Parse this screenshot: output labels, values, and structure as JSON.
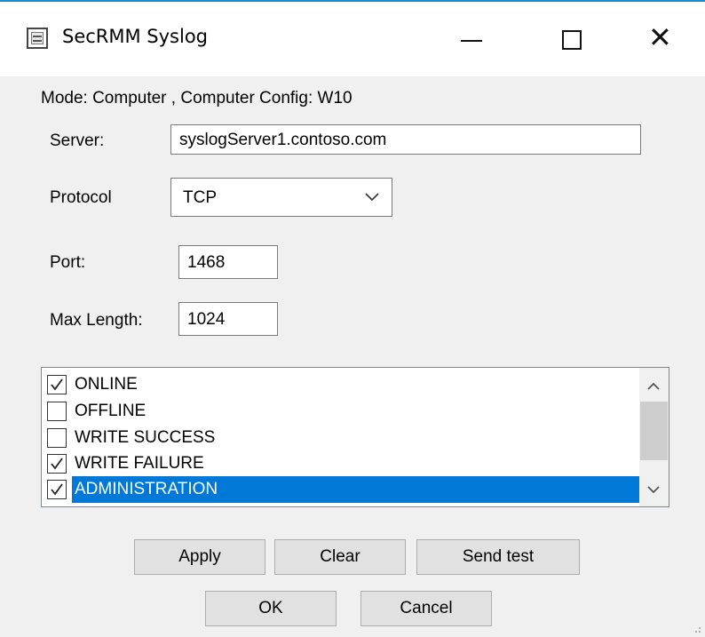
{
  "window": {
    "title": "SecRMM Syslog",
    "controls": {
      "minimize": "—",
      "maximize": "☐",
      "close": "✕"
    }
  },
  "mode_text": "Mode: Computer , Computer Config: W10",
  "form": {
    "server_label": "Server:",
    "server_value": "syslogServer1.contoso.com",
    "protocol_label": "Protocol",
    "protocol_value": "TCP",
    "port_label": "Port:",
    "port_value": "1468",
    "maxlength_label": "Max Length:",
    "maxlength_value": "1024"
  },
  "events": [
    {
      "label": "ONLINE",
      "checked": true,
      "selected": false
    },
    {
      "label": "OFFLINE",
      "checked": false,
      "selected": false
    },
    {
      "label": "WRITE SUCCESS",
      "checked": false,
      "selected": false
    },
    {
      "label": "WRITE FAILURE",
      "checked": true,
      "selected": false
    },
    {
      "label": "ADMINISTRATION",
      "checked": true,
      "selected": true
    }
  ],
  "buttons": {
    "apply": "Apply",
    "clear": "Clear",
    "send_test": "Send test",
    "ok": "OK",
    "cancel": "Cancel"
  },
  "colors": {
    "selection": "#0078d7",
    "titlebar_accent": "#1a8ad6"
  }
}
